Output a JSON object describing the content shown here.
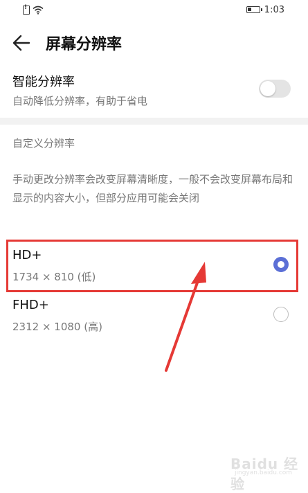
{
  "status_bar": {
    "time": "1:03"
  },
  "header": {
    "title": "屏幕分辨率"
  },
  "smart_resolution": {
    "title": "智能分辨率",
    "subtitle": "自动降低分辨率，有助于省电",
    "enabled": false
  },
  "custom": {
    "label": "自定义分辨率",
    "description": "手动更改分辨率会改变屏幕清晰度，一般不会改变屏幕布局和显示的内容大小，但部分应用可能会关闭"
  },
  "options": [
    {
      "name": "HD+",
      "detail": "1734 × 810 (低)",
      "selected": true
    },
    {
      "name": "FHD+",
      "detail": "2312 × 1080 (高)",
      "selected": false
    }
  ],
  "colors": {
    "accent": "#5b6fd6",
    "annotation": "#e53935"
  },
  "watermark": {
    "logo": "Baidu 经验",
    "url": "jingyan.baidu.com"
  }
}
